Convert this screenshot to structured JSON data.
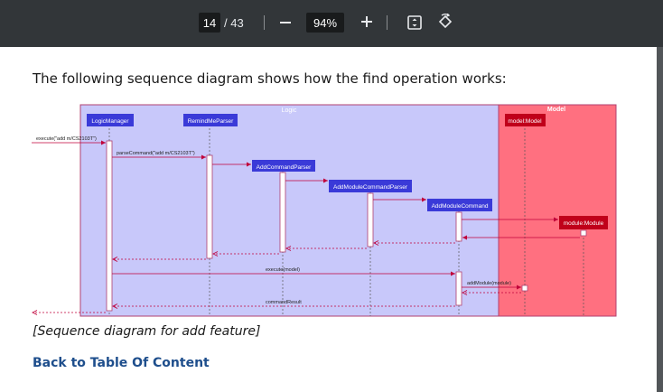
{
  "toolbar": {
    "current_page": "14",
    "total_pages": "/ 43",
    "zoom_out_icon": "minus-icon",
    "zoom_level": "94%",
    "zoom_in_icon": "plus-icon",
    "fit_icon": "fit-to-page-icon",
    "rotate_icon": "rotate-icon"
  },
  "page": {
    "intro_text": "The following sequence diagram shows how the find operation works:",
    "caption": "[Sequence diagram for add feature]",
    "toc_link": "Back to Table Of Content"
  },
  "diagram": {
    "logic_frame_label": "Logic",
    "model_frame_label": "Model",
    "participants": {
      "logic_manager": "LogicManager",
      "remindme_parser": "RemindMeParser",
      "add_command_parser": "AddCommandParser",
      "add_module_command_parser": "AddModuleCommandParser",
      "add_module_command": "AddModuleCommand",
      "model": "model:Model",
      "module": "module:Module"
    },
    "messages": {
      "execute_call": "execute(\"add m/CS2103T\")",
      "parse_command": "parseCommand(\"add m/CS2103T\")",
      "execute_model": "execute(model)",
      "add_module": "addModule(module)",
      "command_result": "commandResult"
    },
    "colors": {
      "logic_fill": "#c8c8fa",
      "model_fill": "#ff7080",
      "participant_blue": "#3a3ad8",
      "participant_red": "#c0001a",
      "arrow": "#c0003a"
    }
  }
}
